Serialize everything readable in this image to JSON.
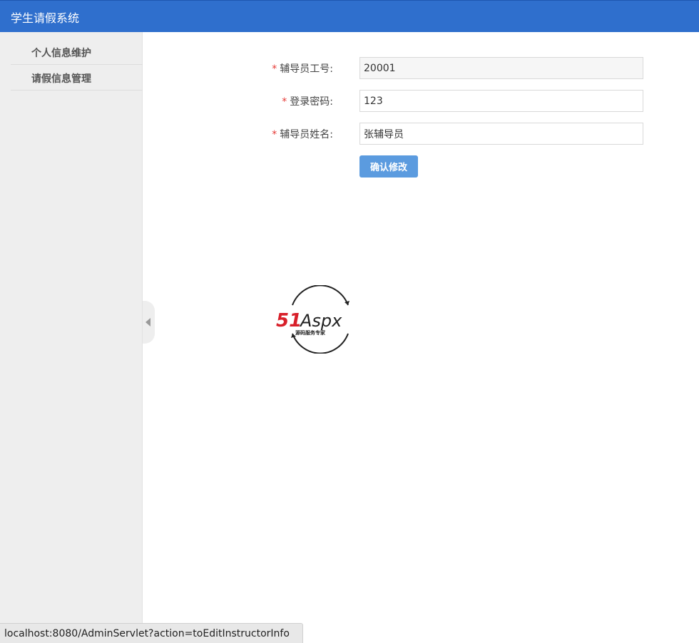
{
  "header": {
    "title": "学生请假系统"
  },
  "sidebar": {
    "items": [
      {
        "label": "个人信息维护"
      },
      {
        "label": "请假信息管理"
      }
    ]
  },
  "form": {
    "required_mark": "*",
    "fields": [
      {
        "label": "辅导员工号:",
        "value": "20001",
        "readonly": true
      },
      {
        "label": "登录密码:",
        "value": "123",
        "readonly": false
      },
      {
        "label": "辅导员姓名:",
        "value": "张辅导员",
        "readonly": false
      }
    ],
    "submit_label": "确认修改"
  },
  "watermark": {
    "brand_number": "51",
    "brand_text": "Aspx",
    "tagline": "源码服务专家",
    "colors": {
      "number": "#d8202a",
      "text": "#222222",
      "accent": "#3aa935"
    }
  },
  "status_bar": {
    "url": "localhost:8080/AdminServlet?action=toEditInstructorInfo"
  },
  "theme": {
    "header_bg": "#2f6fcd",
    "button_bg": "#5b9bdf",
    "sidebar_bg": "#eeeeee"
  }
}
